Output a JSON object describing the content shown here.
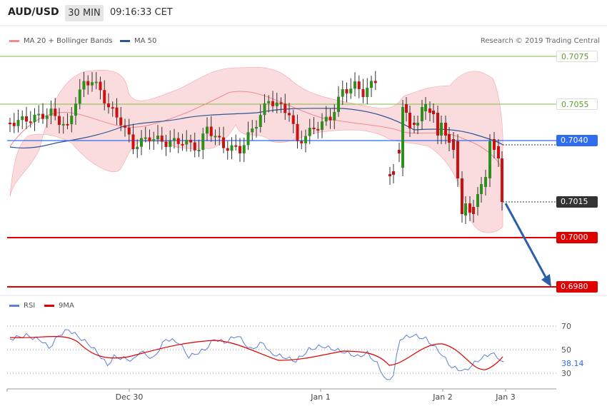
{
  "header": {
    "symbol": "AUD/USD",
    "timeframe": "30 MIN",
    "time": "09:16:33 CET"
  },
  "legend": {
    "bollinger_label": "MA 20 + Bollinger Bands",
    "ma50_label": "MA 50",
    "credit": "Research © 2019 Trading Central",
    "rsi_label": "RSI",
    "rsi_ma_label": "9MA"
  },
  "levels": {
    "l1": "0.7075",
    "l2": "0.7055",
    "l3": "0.7040",
    "l4": "0.7015",
    "l5": "0.7000",
    "l6": "0.6980"
  },
  "rsi_axis": {
    "t70": "70",
    "t50": "50",
    "current": "38.14",
    "t30": "30"
  },
  "x_axis": {
    "d1": "Dec 30",
    "d2": "Jan 1",
    "d3": "Jan 2",
    "d4": "Jan 3"
  },
  "colors": {
    "green_level": "#7cbf3c",
    "blue_level": "#2f6cf0",
    "red_level": "#e00000",
    "candle_up": "#2f8f1e",
    "candle_down": "#cc1111",
    "bollinger": "#f7b2b6",
    "ma50": "#2f5596",
    "rsi": "#5b7fdb",
    "rsi_ma": "#e00000",
    "forecast_arrow": "#2c5fa8"
  }
}
